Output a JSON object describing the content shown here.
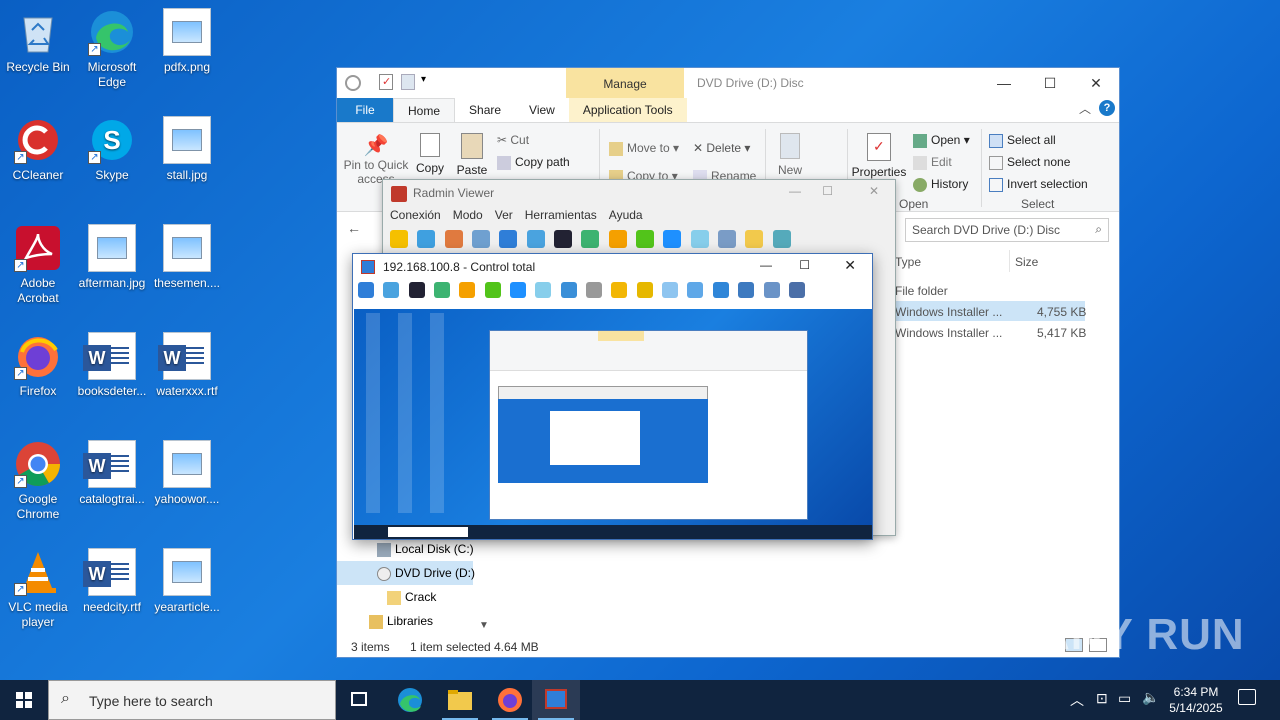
{
  "desktop": {
    "icons": [
      {
        "label": "Recycle Bin",
        "icon": "recycle-bin-icon"
      },
      {
        "label": "Microsoft Edge",
        "icon": "edge-icon"
      },
      {
        "label": "pdfx.png",
        "icon": "image-file-icon"
      },
      {
        "label": "CCleaner",
        "icon": "ccleaner-icon"
      },
      {
        "label": "Skype",
        "icon": "skype-icon"
      },
      {
        "label": "stall.jpg",
        "icon": "image-file-icon"
      },
      {
        "label": "Adobe Acrobat",
        "icon": "acrobat-icon"
      },
      {
        "label": "afterman.jpg",
        "icon": "image-file-icon"
      },
      {
        "label": "thesemen....",
        "icon": "image-file-icon"
      },
      {
        "label": "Firefox",
        "icon": "firefox-icon"
      },
      {
        "label": "booksdeter...",
        "icon": "word-doc-icon"
      },
      {
        "label": "waterxxx.rtf",
        "icon": "word-doc-icon"
      },
      {
        "label": "Google Chrome",
        "icon": "chrome-icon"
      },
      {
        "label": "catalogtrai...",
        "icon": "word-doc-icon"
      },
      {
        "label": "yahoowor....",
        "icon": "image-file-icon"
      },
      {
        "label": "VLC media player",
        "icon": "vlc-icon"
      },
      {
        "label": "needcity.rtf",
        "icon": "word-doc-icon"
      },
      {
        "label": "yeararticle...",
        "icon": "image-file-icon"
      }
    ],
    "watermark": "ANY RUN"
  },
  "explorer": {
    "title": "DVD Drive (D:) Disc",
    "manage_tab": "Manage",
    "tabs": [
      "File",
      "Home",
      "Share",
      "View",
      "Application Tools"
    ],
    "clipboard": {
      "pin": "Pin to Quick access",
      "copy": "Copy",
      "paste": "Paste",
      "cut": "Cut",
      "copy_path": "Copy path"
    },
    "organize": {
      "move_to": "Move to",
      "copy_to": "Copy to",
      "delete": "Delete",
      "rename": "Rename"
    },
    "new": {
      "new": "New"
    },
    "open": {
      "properties": "Properties",
      "open": "Open",
      "edit": "Edit",
      "history": "History",
      "group": "Open"
    },
    "select": {
      "select_all": "Select all",
      "select_none": "Select none",
      "invert": "Invert selection",
      "group": "Select"
    },
    "search_placeholder": "Search DVD Drive (D:) Disc",
    "columns": {
      "type": "Type",
      "size": "Size"
    },
    "rows": [
      {
        "type": "File folder",
        "size": ""
      },
      {
        "type": "Windows Installer ...",
        "size": "4,755 KB"
      },
      {
        "type": "Windows Installer ...",
        "size": "5,417 KB"
      }
    ],
    "nav": [
      {
        "label": "Local Disk (C:)"
      },
      {
        "label": "DVD Drive (D:)"
      },
      {
        "label": "Crack"
      },
      {
        "label": "Libraries"
      }
    ],
    "status": {
      "items": "3 items",
      "selected": "1 item selected",
      "size": "4.64 MB"
    }
  },
  "radmin": {
    "title": "Radmin Viewer",
    "menu": [
      "Conexión",
      "Modo",
      "Ver",
      "Herramientas",
      "Ayuda"
    ]
  },
  "control": {
    "title": "192.168.100.8 - Control total"
  },
  "taskbar": {
    "search_placeholder": "Type here to search",
    "time": "6:34 PM",
    "date": "5/14/2025"
  }
}
